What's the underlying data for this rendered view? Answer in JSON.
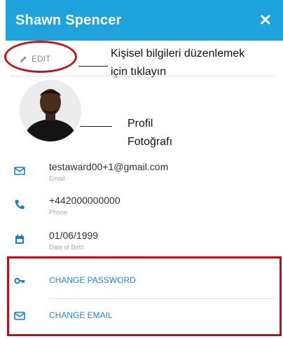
{
  "header": {
    "title": "Shawn Spencer",
    "close_label": "✕"
  },
  "edit": {
    "label": "EDIT",
    "annotation_line1": "Kişisel bilgileri düzenlemek",
    "annotation_line2": "için tıklayın"
  },
  "avatar": {
    "annotation_line1": "Profil",
    "annotation_line2": "Fotoğrafı"
  },
  "info": [
    {
      "value": "testaward00+1@gmail.com",
      "label": "Email",
      "icon": "mail-icon"
    },
    {
      "value": "+442000000000",
      "label": "Phone",
      "icon": "phone-icon"
    },
    {
      "value": "01/06/1999",
      "label": "Date of Birth",
      "icon": "calendar-icon"
    }
  ],
  "actions": [
    {
      "label": "CHANGE PASSWORD",
      "icon": "key-icon"
    },
    {
      "label": "CHANGE EMAIL",
      "icon": "mail-icon"
    }
  ],
  "colors": {
    "primary": "#1ea3dd",
    "highlight": "#c0161e",
    "link": "#2a86c7"
  }
}
